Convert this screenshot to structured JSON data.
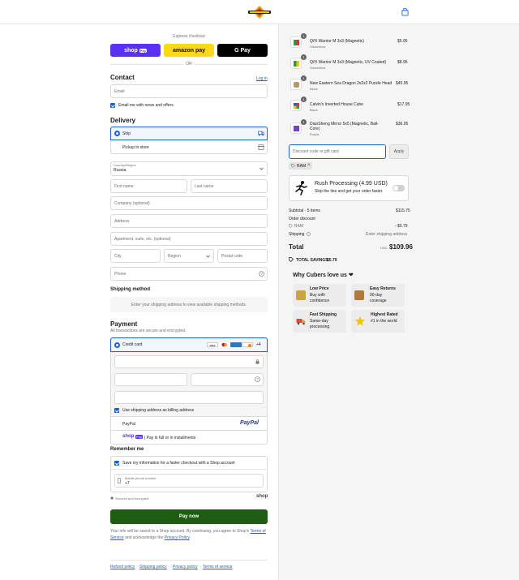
{
  "header": {
    "logo_alt": "store logo",
    "bag_icon": "shopping-bag-icon"
  },
  "express": {
    "title": "Express checkout",
    "shop_pay": "shop",
    "shop_pay_badge": "Pay",
    "amazon": "amazon pay",
    "gpay": "G Pay",
    "or": "OR"
  },
  "contact": {
    "heading": "Contact",
    "login": "Log in",
    "email_placeholder": "Email",
    "news_label": "Email me with news and offers"
  },
  "delivery": {
    "heading": "Delivery",
    "ship": "Ship",
    "pickup": "Pickup in store",
    "country_label": "Country/Region",
    "country_value": "Russia",
    "first_name": "First name",
    "last_name": "Last name",
    "company": "Company (optional)",
    "address": "Address",
    "apartment": "Apartment, suite, etc. (optional)",
    "city": "City",
    "region": "Region",
    "postal": "Postal code",
    "phone": "Phone"
  },
  "shipping_method": {
    "heading": "Shipping method",
    "message": "Enter your shipping address to view available shipping methods."
  },
  "payment": {
    "heading": "Payment",
    "subtitle": "All transactions are secure and encrypted.",
    "credit_card": "Credit card",
    "more_cards": "+4",
    "billing_label": "Use shipping address as billing address",
    "paypal": "PayPal",
    "paypal_logo": "PayPal",
    "shop_pay_label": "| Pay in full or in installments",
    "shop_pay_logo": "shop",
    "shop_pay_badge": "Pay"
  },
  "remember": {
    "heading": "Remember me",
    "save_label": "Save my information for a faster checkout with a Shop account",
    "phone_label": "Mobile phone number",
    "phone_value": "+7",
    "secure": "Secured and encrypted",
    "shop_logo": "shop"
  },
  "pay_button": "Pay now",
  "legal": {
    "text_1": "Your info will be saved to a Shop account. By continuing, you agree to Shop's",
    "terms_link": "Terms of Service",
    "text_2": "and acknowledge the",
    "privacy_link": "Privacy Policy",
    "period": "."
  },
  "footer_links": [
    "Refund policy",
    "Shipping policy",
    "Privacy policy",
    "Terms of service"
  ],
  "cart": {
    "items": [
      {
        "qty": "1",
        "name": "QiYi Warrior M 3x3 (Magnetic)",
        "variant": "Stickerless",
        "price": "$5.95"
      },
      {
        "qty": "1",
        "name": "QiYi Warrior M 3x3 (Magnetic, UV Coated)",
        "variant": "Stickerless",
        "price": "$8.95"
      },
      {
        "qty": "1",
        "name": "New Eastern Sea Dragon 2x2x2 Puzzle Head",
        "variant": "Black",
        "price": "$45.95"
      },
      {
        "qty": "1",
        "name": "Calvin's Inverted House Cube",
        "variant": "Black",
        "price": "$17.95"
      },
      {
        "qty": "1",
        "name": "DianSheng Mirror 5x5 (Magnetic, Ball-",
        "name2": "Core)",
        "variant": "Purple",
        "price": "$36.95"
      }
    ],
    "discount_placeholder": "Discount code or gift card",
    "apply": "Apply",
    "tag": "RAM",
    "rush_title": "Rush Processing (4.99 USD)",
    "rush_sub": "Skip the line and get your order faster.",
    "subtotal_label": "Subtotal · 5 items",
    "subtotal": "$115.75",
    "order_discount_label": "Order discount",
    "discount_code": "RAM",
    "discount_value": "- $5.79",
    "shipping_label": "Shipping",
    "shipping_value": "Enter shipping address",
    "total_label": "Total",
    "currency": "USD",
    "total": "$109.96",
    "savings_label": "TOTAL SAVINGS",
    "savings": "$5.79"
  },
  "why": {
    "heading": "Why Cubers love us ❤",
    "features": [
      {
        "title": "Low Price",
        "line1": "Buy with",
        "line2": "confidence"
      },
      {
        "title": "Easy Returns",
        "line1": "90-day",
        "line2": "coverage"
      },
      {
        "title": "Fast Shipping",
        "line1": "Same-day",
        "line2": "processing"
      },
      {
        "title": "Highest Rated",
        "line1": "#1 in the world",
        "line2": ""
      }
    ]
  },
  "colors": {
    "primary": "#1b5fd6",
    "pay_button": "#1d5c12",
    "shop_pay": "#5a31f4",
    "amazon": "#ffd814"
  }
}
